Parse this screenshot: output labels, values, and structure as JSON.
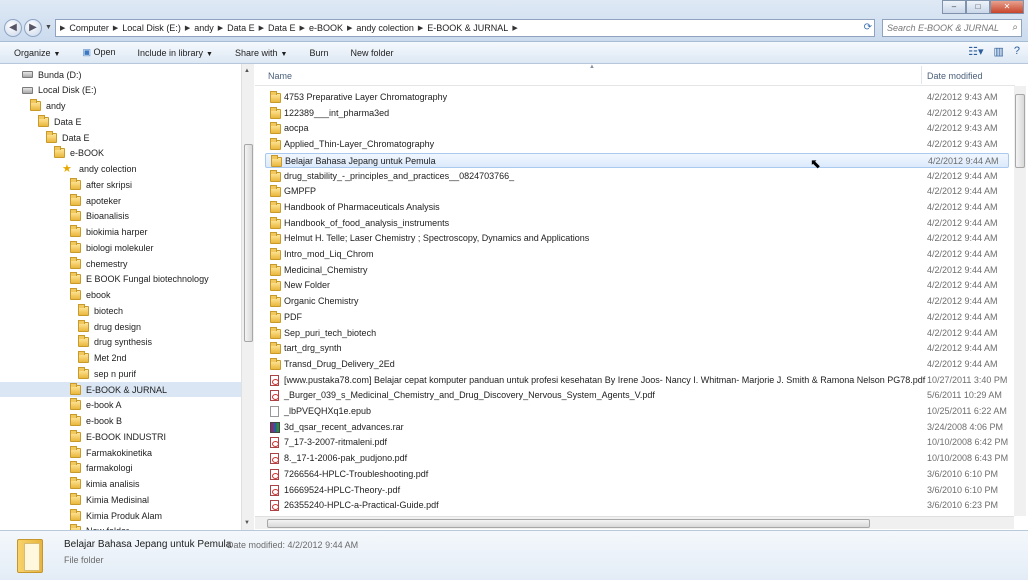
{
  "window": {
    "controls": [
      "–",
      "□",
      "✕"
    ]
  },
  "address": {
    "crumbs": [
      "Computer",
      "Local Disk (E:)",
      "andy",
      "Data E",
      "Data E",
      "e-BOOK",
      "andy colection",
      "E-BOOK & JURNAL"
    ],
    "search_placeholder": "Search E-BOOK & JURNAL"
  },
  "toolbar": {
    "organize": "Organize",
    "open": "Open",
    "include_in_library": "Include in library",
    "share_with": "Share with",
    "burn": "Burn",
    "new_folder": "New folder"
  },
  "tree": [
    {
      "label": "Bunda (D:)",
      "indent": 0,
      "icon": "drive"
    },
    {
      "label": "Local Disk (E:)",
      "indent": 0,
      "icon": "drive"
    },
    {
      "label": "andy",
      "indent": 1,
      "icon": "folder"
    },
    {
      "label": "Data E",
      "indent": 2,
      "icon": "folder"
    },
    {
      "label": "Data E",
      "indent": 3,
      "icon": "folder"
    },
    {
      "label": "e-BOOK",
      "indent": 4,
      "icon": "folder"
    },
    {
      "label": "andy colection",
      "indent": 5,
      "icon": "star"
    },
    {
      "label": "after skripsi",
      "indent": 6,
      "icon": "folder"
    },
    {
      "label": "apoteker",
      "indent": 6,
      "icon": "folder"
    },
    {
      "label": "Bioanalisis",
      "indent": 6,
      "icon": "folder"
    },
    {
      "label": "biokimia harper",
      "indent": 6,
      "icon": "folder"
    },
    {
      "label": "biologi molekuler",
      "indent": 6,
      "icon": "folder"
    },
    {
      "label": "chemestry",
      "indent": 6,
      "icon": "folder"
    },
    {
      "label": "E BOOK Fungal biotechnology",
      "indent": 6,
      "icon": "folder"
    },
    {
      "label": "ebook",
      "indent": 6,
      "icon": "folder"
    },
    {
      "label": "biotech",
      "indent": 7,
      "icon": "folder"
    },
    {
      "label": "drug design",
      "indent": 7,
      "icon": "folder"
    },
    {
      "label": "drug synthesis",
      "indent": 7,
      "icon": "folder"
    },
    {
      "label": "Met 2nd",
      "indent": 7,
      "icon": "folder"
    },
    {
      "label": "sep n purif",
      "indent": 7,
      "icon": "folder"
    },
    {
      "label": "E-BOOK & JURNAL",
      "indent": 6,
      "icon": "folder",
      "selected": true
    },
    {
      "label": "e-book A",
      "indent": 6,
      "icon": "folder"
    },
    {
      "label": "e-book B",
      "indent": 6,
      "icon": "folder"
    },
    {
      "label": "E-BOOK INDUSTRI",
      "indent": 6,
      "icon": "folder"
    },
    {
      "label": "Farmakokinetika",
      "indent": 6,
      "icon": "folder"
    },
    {
      "label": "farmakologi",
      "indent": 6,
      "icon": "folder"
    },
    {
      "label": "kimia analisis",
      "indent": 6,
      "icon": "folder"
    },
    {
      "label": "Kimia Medisinal",
      "indent": 6,
      "icon": "folder"
    },
    {
      "label": "Kimia Produk Alam",
      "indent": 6,
      "icon": "folder"
    },
    {
      "label": "New folder",
      "indent": 6,
      "icon": "folder"
    }
  ],
  "columns": {
    "name": "Name",
    "date": "Date modified"
  },
  "files": [
    {
      "name": "4753 Preparative Layer Chromatography",
      "date": "4/2/2012 9:43 AM",
      "icon": "folder"
    },
    {
      "name": "122389___int_pharma3ed",
      "date": "4/2/2012 9:43 AM",
      "icon": "folder"
    },
    {
      "name": "aocpa",
      "date": "4/2/2012 9:43 AM",
      "icon": "folder"
    },
    {
      "name": "Applied_Thin-Layer_Chromatography",
      "date": "4/2/2012 9:43 AM",
      "icon": "folder"
    },
    {
      "name": "Belajar Bahasa Jepang untuk Pemula",
      "date": "4/2/2012 9:44 AM",
      "icon": "folder",
      "hover": true
    },
    {
      "name": "drug_stability_-_principles_and_practices__0824703766_",
      "date": "4/2/2012 9:44 AM",
      "icon": "folder"
    },
    {
      "name": "GMPFP",
      "date": "4/2/2012 9:44 AM",
      "icon": "folder"
    },
    {
      "name": "Handbook of Pharmaceuticals Analysis",
      "date": "4/2/2012 9:44 AM",
      "icon": "folder"
    },
    {
      "name": "Handbook_of_food_analysis_instruments",
      "date": "4/2/2012 9:44 AM",
      "icon": "folder"
    },
    {
      "name": "Helmut H. Telle;  Laser Chemistry ; Spectroscopy, Dynamics and Applications",
      "date": "4/2/2012 9:44 AM",
      "icon": "folder"
    },
    {
      "name": "Intro_mod_Liq_Chrom",
      "date": "4/2/2012 9:44 AM",
      "icon": "folder"
    },
    {
      "name": "Medicinal_Chemistry",
      "date": "4/2/2012 9:44 AM",
      "icon": "folder"
    },
    {
      "name": "New Folder",
      "date": "4/2/2012 9:44 AM",
      "icon": "folder"
    },
    {
      "name": "Organic Chemistry",
      "date": "4/2/2012 9:44 AM",
      "icon": "folder"
    },
    {
      "name": "PDF",
      "date": "4/2/2012 9:44 AM",
      "icon": "folder"
    },
    {
      "name": "Sep_puri_tech_biotech",
      "date": "4/2/2012 9:44 AM",
      "icon": "folder"
    },
    {
      "name": "tart_drg_synth",
      "date": "4/2/2012 9:44 AM",
      "icon": "folder"
    },
    {
      "name": "Transd_Drug_Delivery_2Ed",
      "date": "4/2/2012 9:44 AM",
      "icon": "folder"
    },
    {
      "name": "[www.pustaka78.com] Belajar cepat komputer panduan untuk profesi kesehatan By Irene Joos- Nancy I. Whitman- Marjorie J. Smith & Ramona Nelson PG78.pdf",
      "date": "10/27/2011 3:40 PM",
      "icon": "pdf"
    },
    {
      "name": "_Burger_039_s_Medicinal_Chemistry_and_Drug_Discovery_Nervous_System_Agents_V.pdf",
      "date": "5/6/2011 10:29 AM",
      "icon": "pdf"
    },
    {
      "name": "_lbPVEQHXq1e.epub",
      "date": "10/25/2011 6:22 AM",
      "icon": "epub"
    },
    {
      "name": "3d_qsar_recent_advances.rar",
      "date": "3/24/2008 4:06 PM",
      "icon": "rar"
    },
    {
      "name": "7_17-3-2007-ritmaleni.pdf",
      "date": "10/10/2008 6:42 PM",
      "icon": "pdf"
    },
    {
      "name": "8._17-1-2006-pak_pudjono.pdf",
      "date": "10/10/2008 6:43 PM",
      "icon": "pdf"
    },
    {
      "name": "7266564-HPLC-Troubleshooting.pdf",
      "date": "3/6/2010 6:10 PM",
      "icon": "pdf"
    },
    {
      "name": "16669524-HPLC-Theory-.pdf",
      "date": "3/6/2010 6:10 PM",
      "icon": "pdf"
    },
    {
      "name": "26355240-HPLC-a-Practical-Guide.pdf",
      "date": "3/6/2010 6:23 PM",
      "icon": "pdf"
    }
  ],
  "details": {
    "name": "Belajar Bahasa Jepang untuk Pemula",
    "modified_label": "Date modified: 4/2/2012 9:44 AM",
    "type": "File folder"
  }
}
